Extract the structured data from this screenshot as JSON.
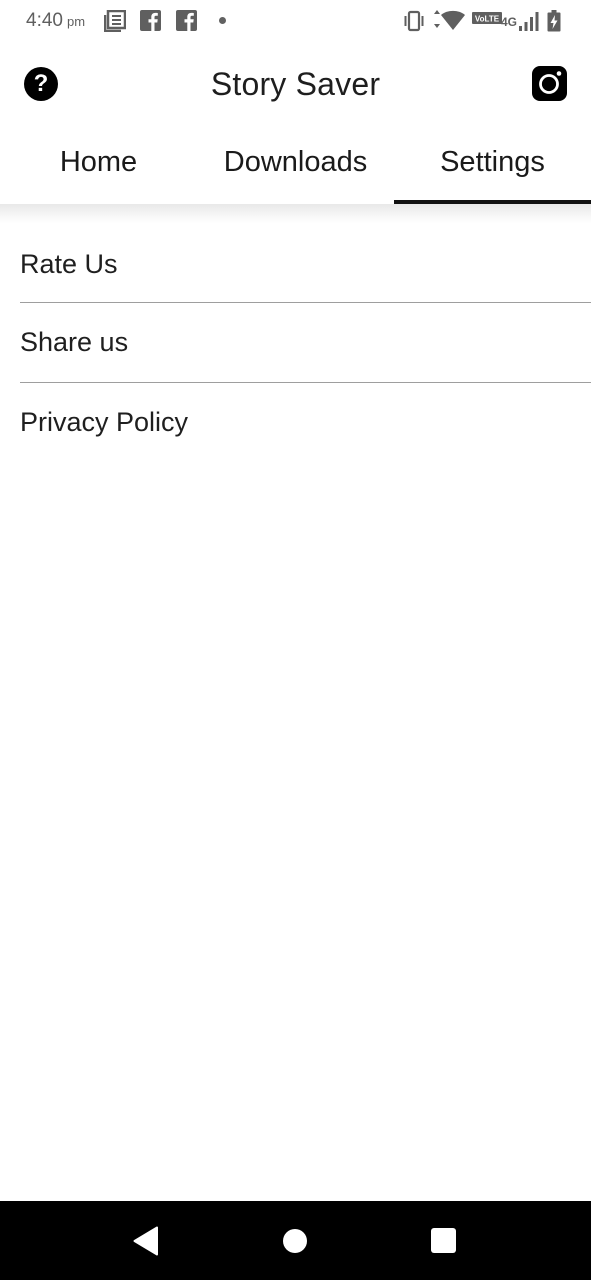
{
  "status_bar": {
    "time": "4:40",
    "ampm": "pm",
    "network_label": "VoLTE",
    "network_type": "4G",
    "icons": [
      "news-icon",
      "facebook-icon",
      "facebook-icon",
      "notification-dot-icon",
      "vibrate-icon",
      "wifi-icon",
      "signal-icon",
      "battery-charging-icon"
    ]
  },
  "app_bar": {
    "title": "Story Saver",
    "help_glyph": "?",
    "left_icon": "help-icon",
    "right_icon": "instagram-icon"
  },
  "tabs": [
    {
      "label": "Home",
      "active": false
    },
    {
      "label": "Downloads",
      "active": false
    },
    {
      "label": "Settings",
      "active": true
    }
  ],
  "settings": {
    "items": [
      {
        "label": "Rate Us"
      },
      {
        "label": "Share us"
      },
      {
        "label": "Privacy Policy"
      }
    ]
  },
  "nav_bar": {
    "icons": [
      "back-icon",
      "home-icon",
      "recents-icon"
    ]
  },
  "colors": {
    "background": "#ffffff",
    "text": "#1a1a1a",
    "tab_indicator": "#111111",
    "nav_bar": "#000000",
    "divider": "#9e9e9e"
  }
}
